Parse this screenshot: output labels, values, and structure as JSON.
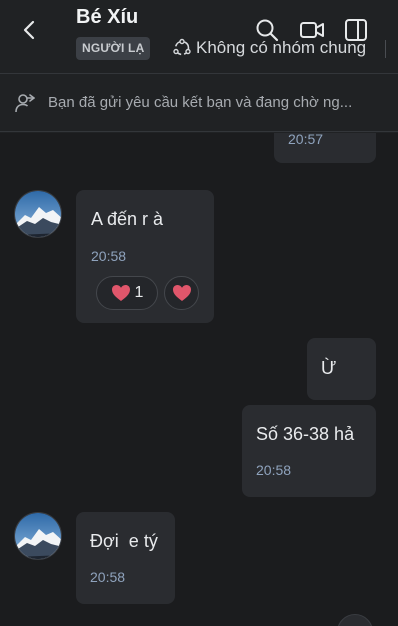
{
  "header": {
    "name": "Bé Xíu",
    "badge": "NGƯỜI LẠ",
    "groups_text": "Không có nhóm chung"
  },
  "friend_request": {
    "text": "Bạn đã gửi yêu cầu kết bạn và đang chờ ng..."
  },
  "messages": [
    {
      "side": "right",
      "text": "",
      "time": "20:57"
    },
    {
      "side": "left",
      "text": "A đến r à",
      "time": "20:58",
      "reactions": [
        {
          "emoji": "heart",
          "count": "1"
        },
        {
          "emoji": "heart"
        }
      ]
    },
    {
      "side": "right",
      "text": "Ừ",
      "time": ""
    },
    {
      "side": "right",
      "text": "Số 36-38 hả",
      "time": "20:58"
    },
    {
      "side": "left",
      "text": "Đợi  e tý",
      "time": "20:58"
    }
  ],
  "colors": {
    "background": "#1b1c1e",
    "bubble": "#2a2c30",
    "time": "#8fa3bd",
    "heart": "#e0566b"
  }
}
